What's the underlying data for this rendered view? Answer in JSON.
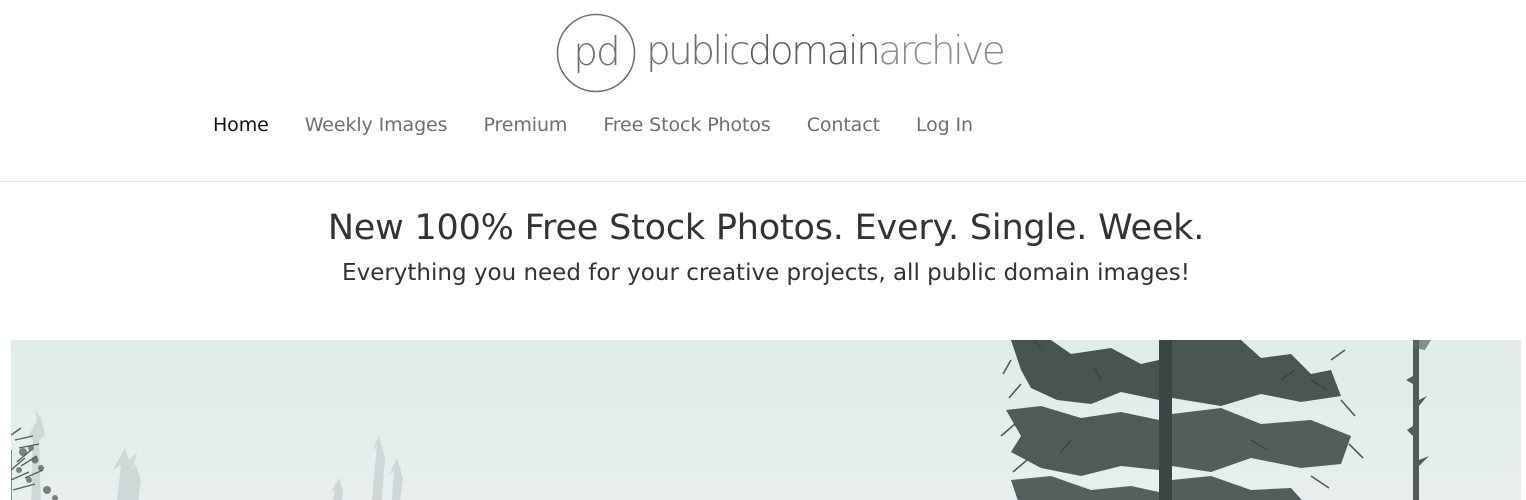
{
  "header": {
    "logo": {
      "monogram": "pd",
      "word_1": "public",
      "word_2": "domain",
      "word_3": "archive"
    },
    "nav": [
      {
        "label": "Home",
        "active": true
      },
      {
        "label": "Weekly Images",
        "active": false
      },
      {
        "label": "Premium",
        "active": false
      },
      {
        "label": "Free Stock Photos",
        "active": false
      },
      {
        "label": "Contact",
        "active": false
      },
      {
        "label": "Log In",
        "active": false
      }
    ]
  },
  "hero": {
    "headline": "New 100% Free Stock Photos. Every. Single. Week.",
    "subline": "Everything you need for your creative projects, all public domain images!"
  },
  "featured_image": {
    "subject": "misty winter forest with pine trees"
  },
  "colors": {
    "text_dark": "#333333",
    "nav_inactive": "#6f6f6f",
    "nav_active": "#111111",
    "divider": "#e2e2e2",
    "photo_sky": "#e5eeeb"
  }
}
